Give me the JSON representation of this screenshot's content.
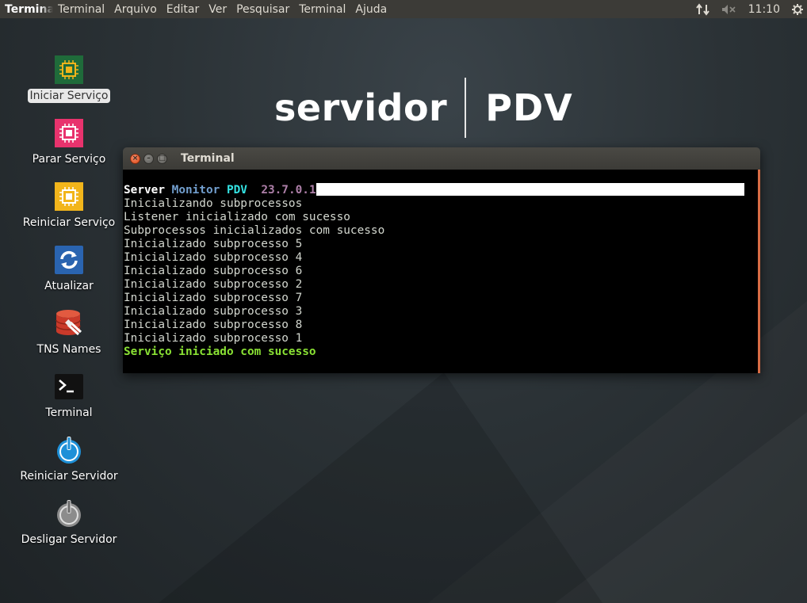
{
  "topbar": {
    "app_name": "Terminal",
    "menu": [
      "Terminal",
      "Arquivo",
      "Editar",
      "Ver",
      "Pesquisar",
      "Terminal",
      "Ajuda"
    ],
    "clock": "11:10",
    "icons": [
      "network-icon",
      "volume-muted-icon",
      "power-icon"
    ]
  },
  "logo": {
    "left": "servidor",
    "right": "PDV"
  },
  "desktop_icons": [
    {
      "label": "Iniciar Serviço",
      "icon": "chip-icon",
      "color": "#1f6b3a"
    },
    {
      "label": "Parar Serviço",
      "icon": "chip-icon",
      "color": "#e8336d"
    },
    {
      "label": "Reiniciar Serviço",
      "icon": "chip-icon",
      "color": "#f2b51b"
    },
    {
      "label": "Atualizar",
      "icon": "refresh-icon",
      "color": "#2a64b0"
    },
    {
      "label": "TNS Names",
      "icon": "database-icon",
      "color": "#d9432f"
    },
    {
      "label": "Terminal",
      "icon": "terminal-icon",
      "color": "#111111"
    },
    {
      "label": "Reiniciar Servidor",
      "icon": "power-blue-icon",
      "color": "#1e90d8"
    },
    {
      "label": "Desligar Servidor",
      "icon": "power-gray-icon",
      "color": "#8c8c8c"
    }
  ],
  "terminal": {
    "title": "Terminal",
    "header": {
      "w1": "Server",
      "w2": "Monitor",
      "w3": "PDV",
      "version": "23.7.0.1"
    },
    "lines": [
      "Inicializando subprocessos",
      "Listener inicializado com sucesso",
      "Subprocessos inicializados com sucesso",
      "Inicializado subprocesso 5",
      "Inicializado subprocesso 4",
      "Inicializado subprocesso 6",
      "Inicializado subprocesso 2",
      "Inicializado subprocesso 7",
      "Inicializado subprocesso 3",
      "Inicializado subprocesso 8",
      "Inicializado subprocesso 1"
    ],
    "success": "Serviço iniciado com sucesso"
  }
}
